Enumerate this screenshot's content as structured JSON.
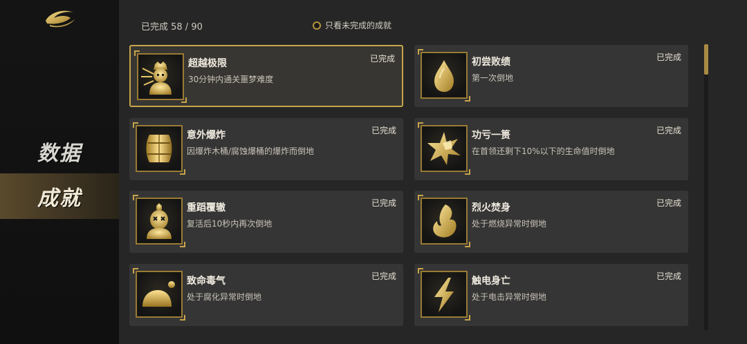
{
  "nav": {
    "items": [
      {
        "label": "数据",
        "selected": false
      },
      {
        "label": "成就",
        "selected": true
      }
    ]
  },
  "header": {
    "progress_text": "已完成 58 / 90",
    "filter_label": "只看未完成的成就",
    "filter_checked": false
  },
  "accent_color": "#c7a54a",
  "achievements": [
    {
      "title": "超越极限",
      "desc": "30分钟内通关噩梦难度",
      "status": "已完成",
      "icon": "warrior-icon",
      "selected": true
    },
    {
      "title": "初尝败绩",
      "desc": "第一次倒地",
      "status": "已完成",
      "icon": "drop-icon",
      "selected": false
    },
    {
      "title": "意外爆炸",
      "desc": "因爆炸木桶/腐蚀爆桶的爆炸而倒地",
      "status": "已完成",
      "icon": "barrel-icon",
      "selected": false
    },
    {
      "title": "功亏一篑",
      "desc": "在首领还剩下10%以下的生命值时倒地",
      "status": "已完成",
      "icon": "star-burst-icon",
      "selected": false
    },
    {
      "title": "重蹈覆辙",
      "desc": "复活后10秒内再次倒地",
      "status": "已完成",
      "icon": "knocked-out-icon",
      "selected": false
    },
    {
      "title": "烈火焚身",
      "desc": "处于燃烧异常时倒地",
      "status": "已完成",
      "icon": "flame-icon",
      "selected": false
    },
    {
      "title": "致命毒气",
      "desc": "处于腐化异常时倒地",
      "status": "已完成",
      "icon": "poison-gas-icon",
      "selected": false
    },
    {
      "title": "触电身亡",
      "desc": "处于电击异常时倒地",
      "status": "已完成",
      "icon": "lightning-icon",
      "selected": false
    }
  ],
  "scroll_position": 0.0
}
